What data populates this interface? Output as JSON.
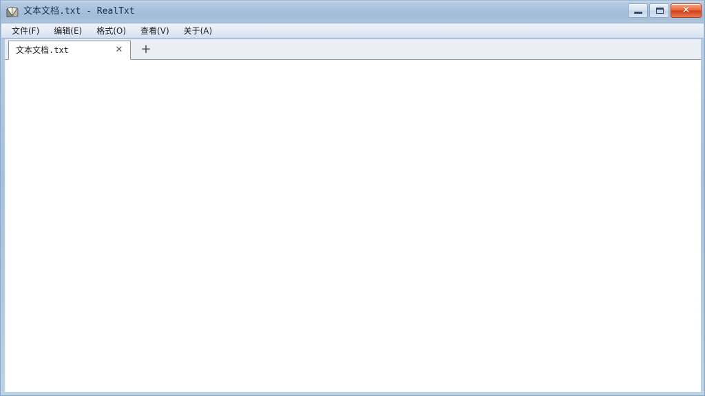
{
  "window": {
    "title": "文本文档.txt - RealTxt",
    "icon": "notepad-book-icon",
    "controls": {
      "minimize_label": "",
      "maximize_label": "",
      "close_label": "✕"
    },
    "frame_color": "#a9c1da",
    "titlebar_text_color": "#16304f"
  },
  "menubar": {
    "items": [
      {
        "label": "文件(F)",
        "name": "file"
      },
      {
        "label": "编辑(E)",
        "name": "edit"
      },
      {
        "label": "格式(O)",
        "name": "format"
      },
      {
        "label": "查看(V)",
        "name": "view"
      },
      {
        "label": "关于(A)",
        "name": "about"
      }
    ]
  },
  "tabs": {
    "items": [
      {
        "label": "文本文档.txt",
        "close_label": "✕",
        "active": true
      }
    ],
    "add_label": "+"
  },
  "editor": {
    "content": "",
    "placeholder": ""
  }
}
